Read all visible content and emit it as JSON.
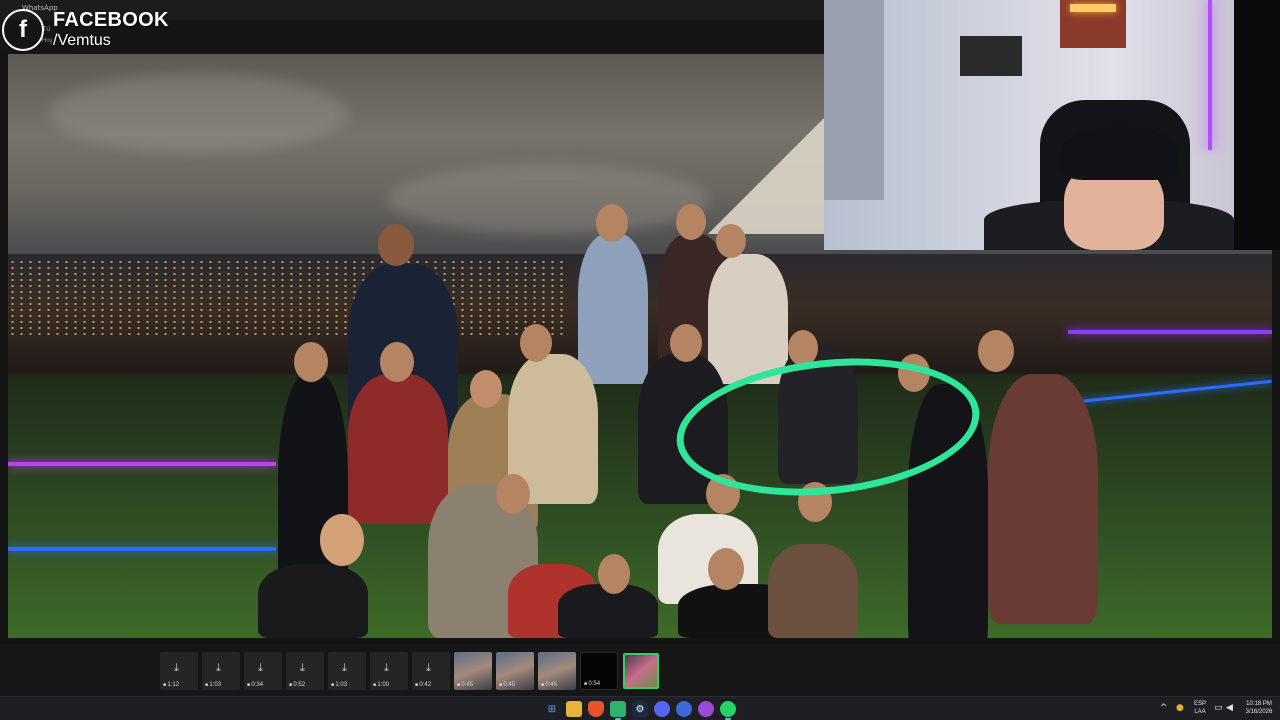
{
  "top": {
    "app_label": "WhatsApp",
    "sub1": "Tú",
    "sub2": "Hoy"
  },
  "watermark": {
    "logo_letter": "f",
    "platform": "FACEBOOK",
    "handle": "/Vemtus"
  },
  "thumbnails": [
    {
      "kind": "download",
      "duration": "1:12"
    },
    {
      "kind": "download",
      "duration": "1:03"
    },
    {
      "kind": "download",
      "duration": "0:34"
    },
    {
      "kind": "download",
      "duration": "0:52"
    },
    {
      "kind": "download",
      "duration": "1:03"
    },
    {
      "kind": "download",
      "duration": "1:00"
    },
    {
      "kind": "download",
      "duration": "0:42"
    },
    {
      "kind": "image",
      "duration": "0:45"
    },
    {
      "kind": "image",
      "duration": "0:45"
    },
    {
      "kind": "image",
      "duration": "0:45"
    },
    {
      "kind": "black",
      "duration": "0:54"
    },
    {
      "kind": "selected",
      "duration": ""
    }
  ],
  "taskbar": {
    "icons": [
      "windows-start",
      "file-explorer",
      "brave-browser",
      "greenshot",
      "steam",
      "discord",
      "app",
      "messenger",
      "whatsapp"
    ],
    "lang_top": "ESP",
    "lang_bottom": "LAA",
    "time": "10:18 PM",
    "date": "3/16/2026"
  },
  "colors": {
    "highlight_circle": "#2fe59a",
    "selected_thumb_border": "#2fd06a",
    "neon_purple": "#c43cff",
    "neon_blue": "#2b6cff"
  }
}
